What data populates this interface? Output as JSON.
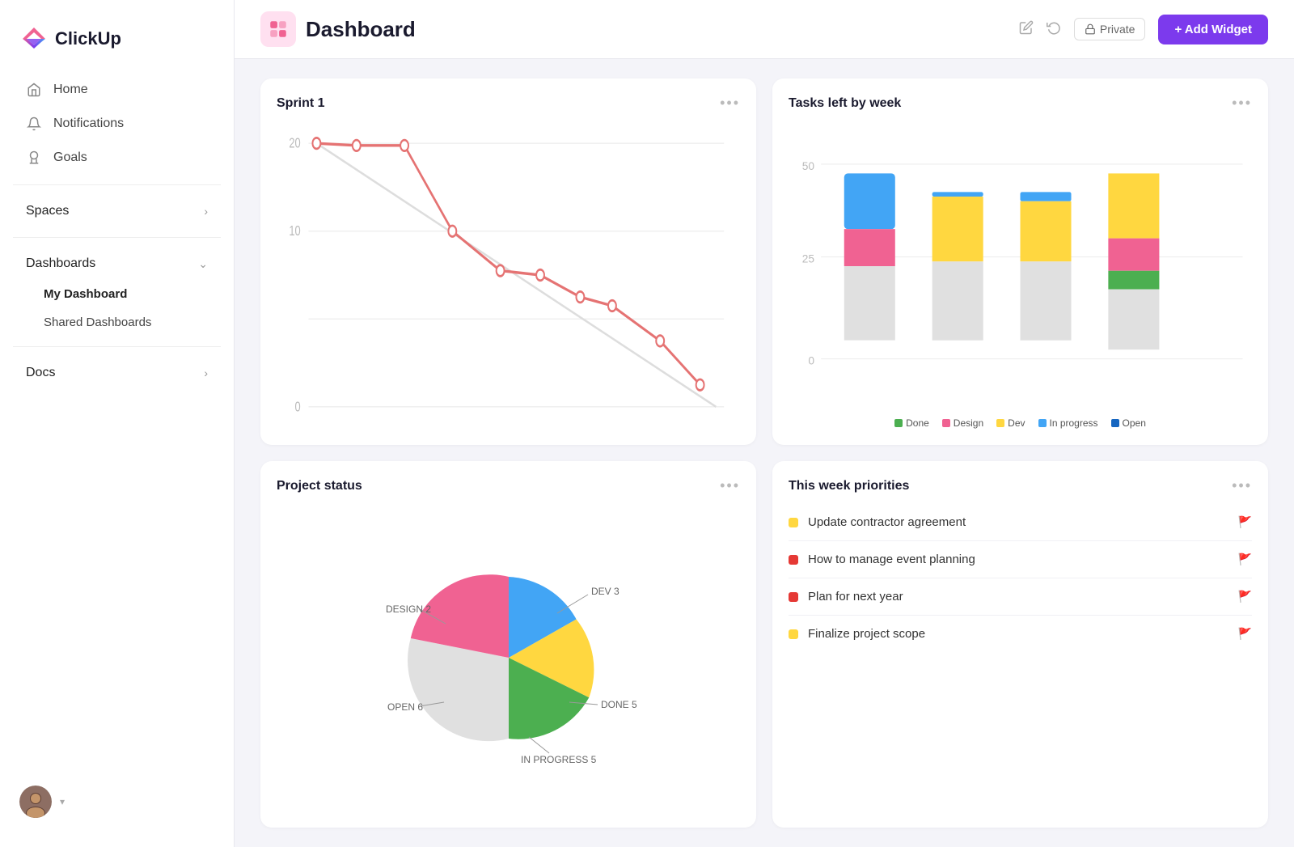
{
  "sidebar": {
    "logo_text": "ClickUp",
    "nav_items": [
      {
        "id": "home",
        "label": "Home",
        "icon": "🏠"
      },
      {
        "id": "notifications",
        "label": "Notifications",
        "icon": "🔔"
      },
      {
        "id": "goals",
        "label": "Goals",
        "icon": "🏆"
      }
    ],
    "spaces_label": "Spaces",
    "dashboards_label": "Dashboards",
    "my_dashboard_label": "My Dashboard",
    "shared_dashboards_label": "Shared Dashboards",
    "docs_label": "Docs"
  },
  "header": {
    "title": "Dashboard",
    "private_label": "Private",
    "add_widget_label": "+ Add Widget"
  },
  "sprint_widget": {
    "title": "Sprint 1",
    "menu": "...",
    "y_labels": [
      "20",
      "10",
      "0"
    ]
  },
  "tasks_widget": {
    "title": "Tasks left by week",
    "menu": "...",
    "legend": [
      {
        "label": "Done",
        "color": "#4caf50"
      },
      {
        "label": "Design",
        "color": "#f06292"
      },
      {
        "label": "Dev",
        "color": "#ffd740"
      },
      {
        "label": "In progress",
        "color": "#42a5f5"
      },
      {
        "label": "Open",
        "color": "#1565c0"
      }
    ],
    "y_labels": [
      "50",
      "25",
      "0"
    ]
  },
  "project_status_widget": {
    "title": "Project status",
    "menu": "...",
    "segments": [
      {
        "label": "DEV 3",
        "color": "#ffd740",
        "value": 3
      },
      {
        "label": "DONE 5",
        "color": "#4caf50",
        "value": 5
      },
      {
        "label": "IN PROGRESS 5",
        "color": "#42a5f5",
        "value": 5
      },
      {
        "label": "OPEN 6",
        "color": "#e0e0e0",
        "value": 6
      },
      {
        "label": "DESIGN 2",
        "color": "#f06292",
        "value": 2
      }
    ]
  },
  "priorities_widget": {
    "title": "This week priorities",
    "menu": "...",
    "items": [
      {
        "text": "Update contractor agreement",
        "dot_color": "#ffd740",
        "flag_color": "#e53935",
        "flag_char": "🚩"
      },
      {
        "text": "How to manage event planning",
        "dot_color": "#e53935",
        "flag_color": "#e53935",
        "flag_char": "🚩"
      },
      {
        "text": "Plan for next year",
        "dot_color": "#e53935",
        "flag_color": "#ffd740",
        "flag_char": "🚩"
      },
      {
        "text": "Finalize project scope",
        "dot_color": "#ffd740",
        "flag_color": "#4caf50",
        "flag_char": "🚩"
      }
    ]
  }
}
